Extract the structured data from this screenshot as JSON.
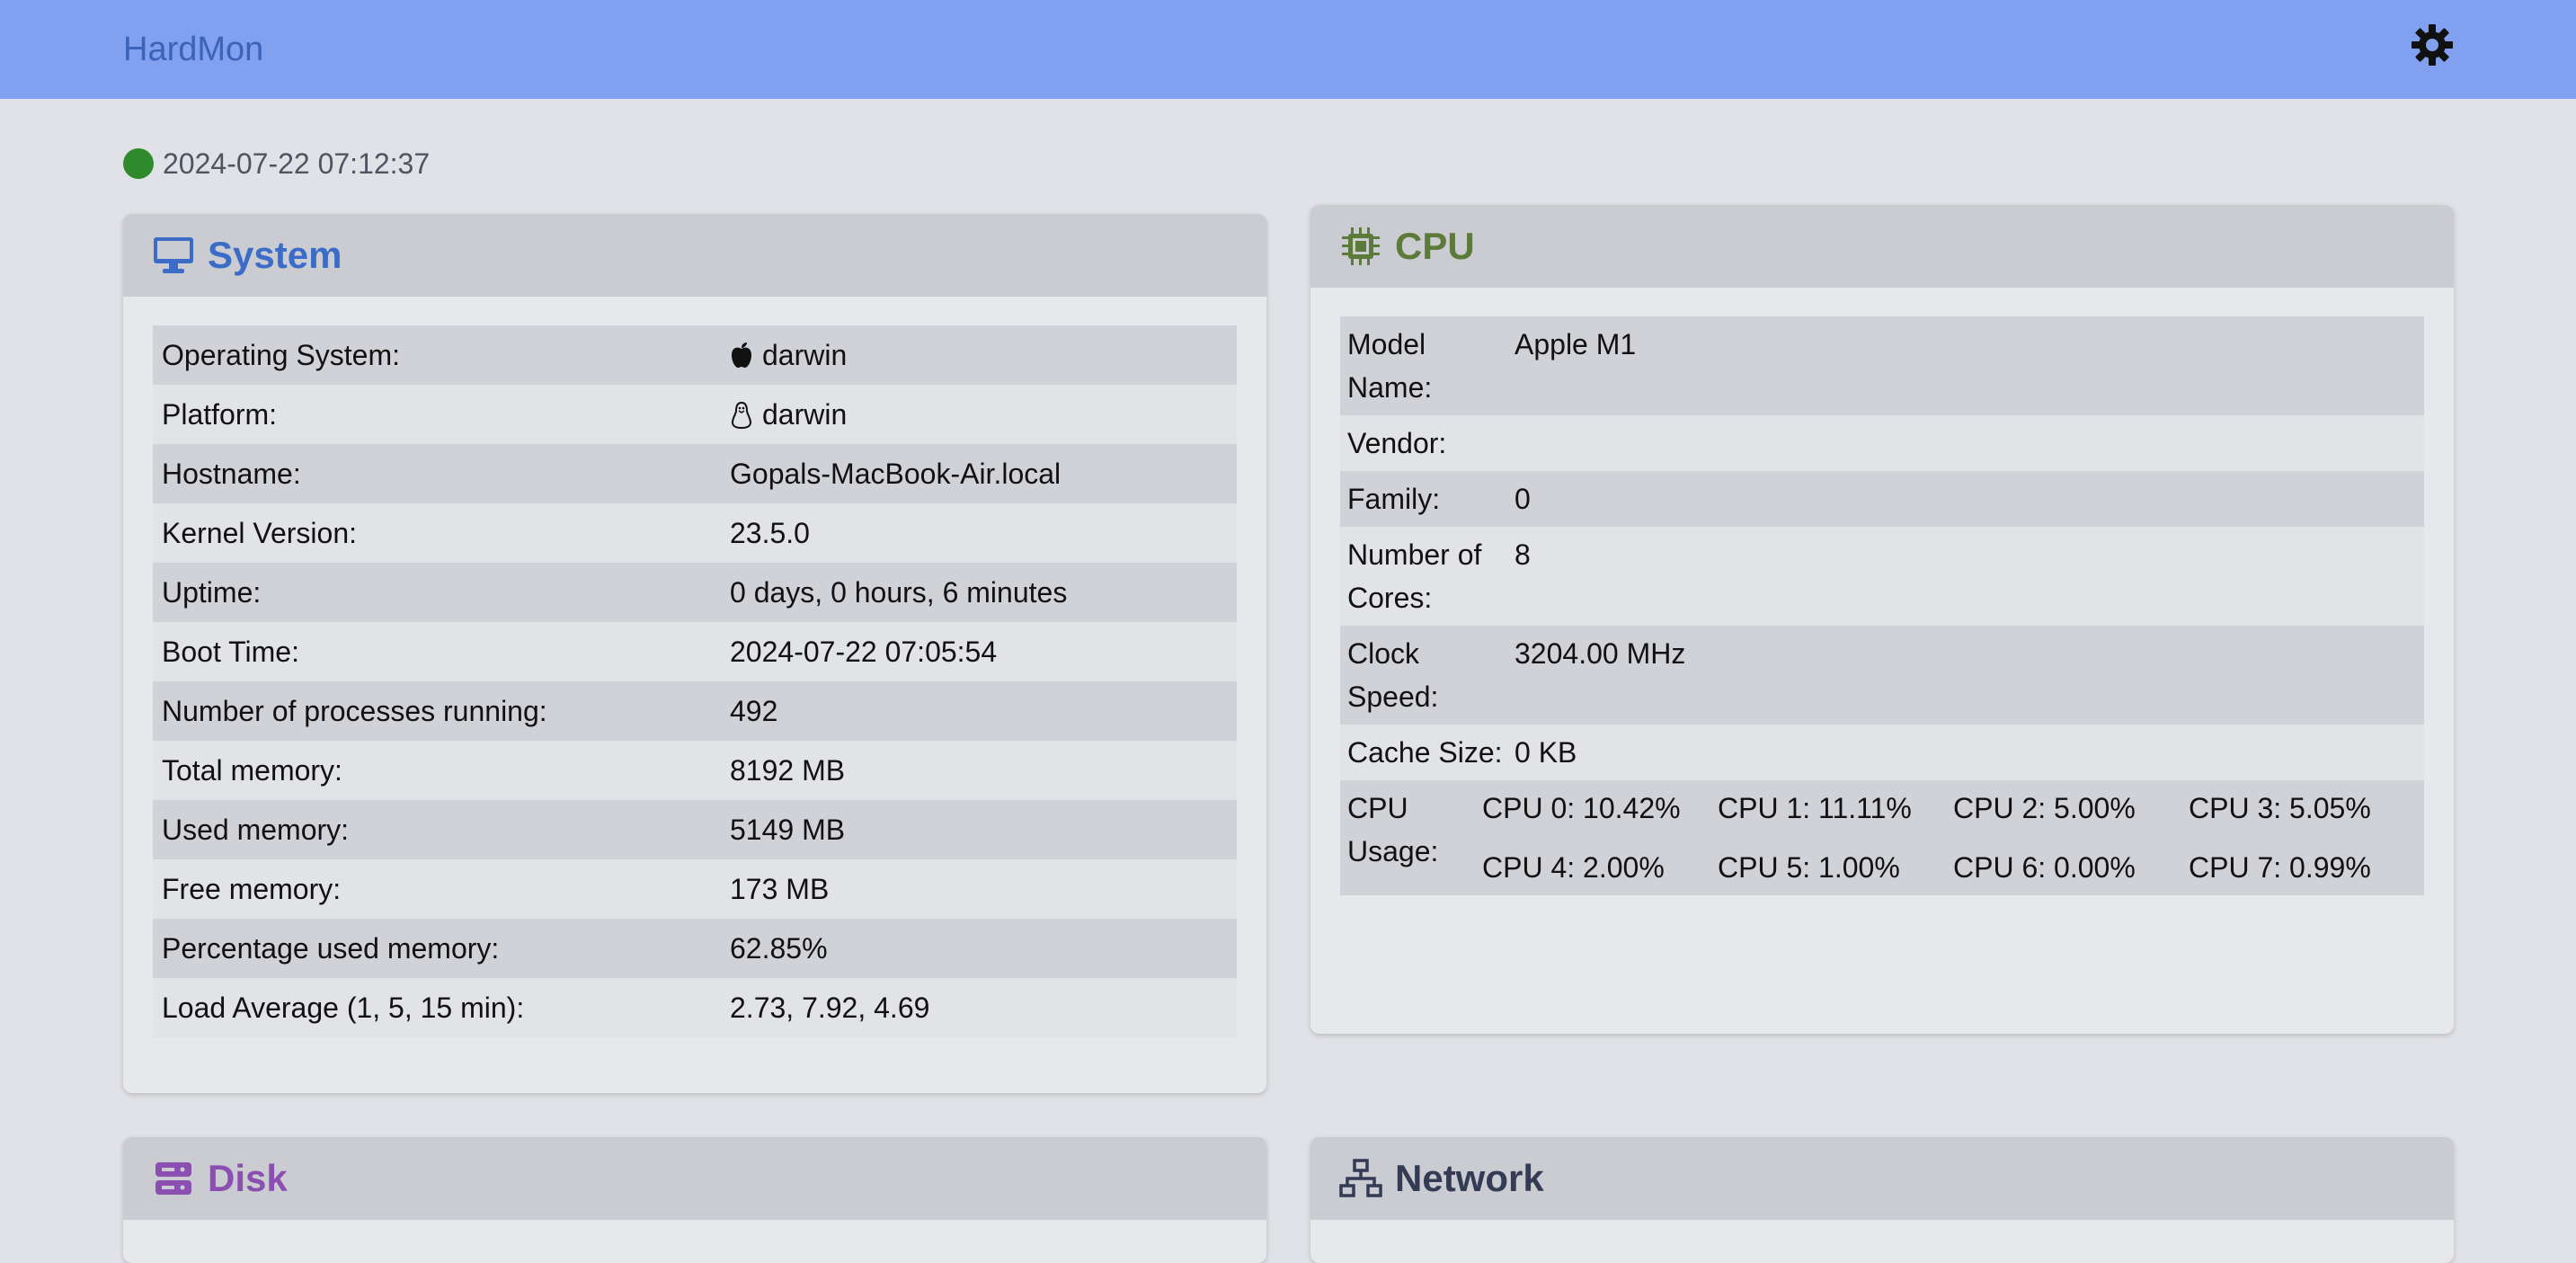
{
  "navbar": {
    "brand": "HardMon",
    "settings_icon": "gear-icon"
  },
  "status": {
    "indicator_color": "#2e8a2a",
    "timestamp": "2024-07-22 07:12:37"
  },
  "system": {
    "title": "System",
    "icon": "monitor-icon",
    "title_color": "#3b6cc8",
    "rows": [
      {
        "label": "Operating System:",
        "value": "darwin",
        "icon": "apple-icon"
      },
      {
        "label": "Platform:",
        "value": "darwin",
        "icon": "linux-penguin-icon"
      },
      {
        "label": "Hostname:",
        "value": "Gopals-MacBook-Air.local"
      },
      {
        "label": "Kernel Version:",
        "value": "23.5.0"
      },
      {
        "label": "Uptime:",
        "value": "0 days, 0 hours, 6 minutes"
      },
      {
        "label": "Boot Time:",
        "value": "2024-07-22 07:05:54"
      },
      {
        "label": "Number of processes running:",
        "value": "492"
      },
      {
        "label": "Total memory:",
        "value": "8192 MB"
      },
      {
        "label": "Used memory:",
        "value": "5149 MB"
      },
      {
        "label": "Free memory:",
        "value": "173 MB"
      },
      {
        "label": "Percentage used memory:",
        "value": "62.85%"
      },
      {
        "label": "Load Average (1, 5, 15 min):",
        "value": "2.73, 7.92, 4.69"
      }
    ]
  },
  "cpu": {
    "title": "CPU",
    "icon": "chip-icon",
    "title_color": "#5c7a3a",
    "rows": [
      {
        "label": "Model Name:",
        "value": "Apple M1"
      },
      {
        "label": "Vendor:",
        "value": ""
      },
      {
        "label": "Family:",
        "value": "0"
      },
      {
        "label": "Number of Cores:",
        "value": "8"
      },
      {
        "label": "Clock Speed:",
        "value": "3204.00 MHz"
      },
      {
        "label": "Cache Size:",
        "value": "0 KB"
      }
    ],
    "usage_label": "CPU Usage:",
    "usage": [
      "CPU 0: 10.42%",
      "CPU 1: 11.11%",
      "CPU 2: 5.00%",
      "CPU 3: 5.05%",
      "CPU 4: 2.00%",
      "CPU 5: 1.00%",
      "CPU 6: 0.00%",
      "CPU 7: 0.99%"
    ]
  },
  "disk": {
    "title": "Disk",
    "icon": "database-icon",
    "title_color": "#8a4fb0"
  },
  "network": {
    "title": "Network",
    "icon": "network-icon",
    "title_color": "#333b55"
  }
}
